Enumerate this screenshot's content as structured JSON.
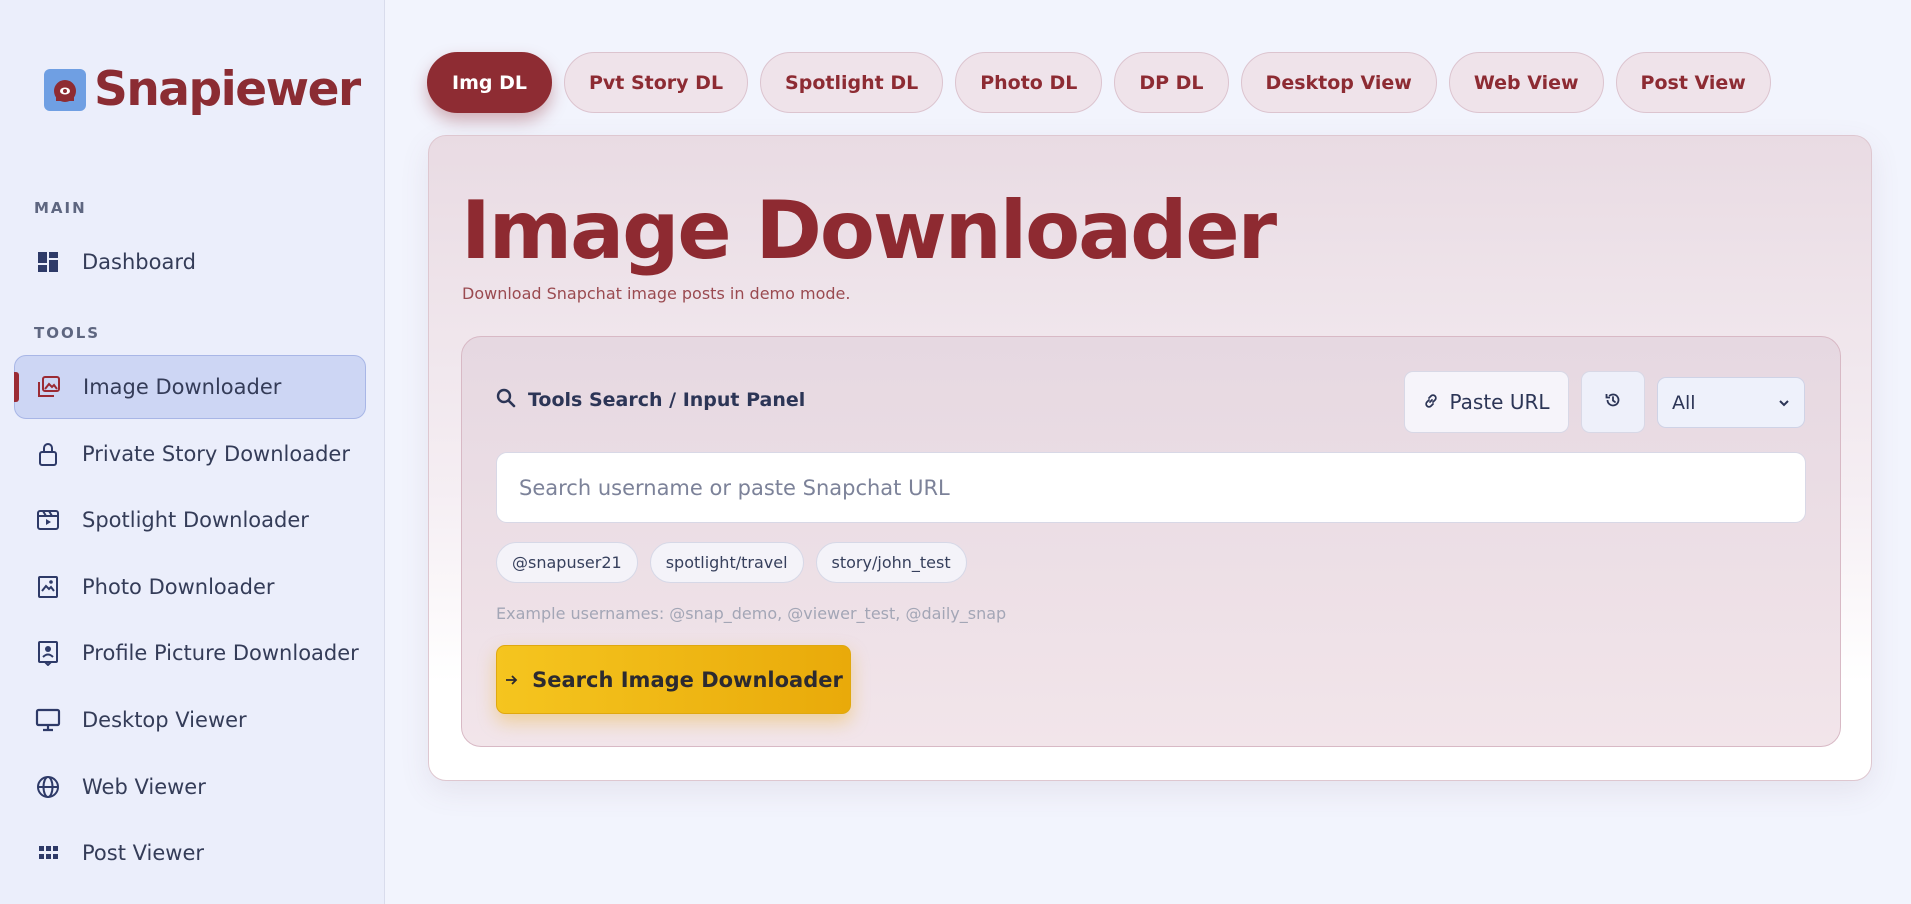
{
  "brand": {
    "name": "Snapiewer"
  },
  "sidebar": {
    "sections": [
      {
        "label": "MAIN"
      },
      {
        "label": "TOOLS"
      }
    ],
    "items": [
      {
        "label": "Dashboard",
        "icon": "dashboard-icon"
      },
      {
        "label": "Image Downloader",
        "icon": "images-icon",
        "active": true
      },
      {
        "label": "Private Story Downloader",
        "icon": "lock-icon"
      },
      {
        "label": "Spotlight Downloader",
        "icon": "video-clapper-icon"
      },
      {
        "label": "Photo Downloader",
        "icon": "photo-icon"
      },
      {
        "label": "Profile Picture Downloader",
        "icon": "profile-picture-icon"
      },
      {
        "label": "Desktop Viewer",
        "icon": "monitor-icon"
      },
      {
        "label": "Web Viewer",
        "icon": "globe-icon"
      },
      {
        "label": "Post Viewer",
        "icon": "grid-icon"
      }
    ]
  },
  "tabs": [
    {
      "label": "Img DL",
      "active": true
    },
    {
      "label": "Pvt Story DL"
    },
    {
      "label": "Spotlight DL"
    },
    {
      "label": "Photo DL"
    },
    {
      "label": "DP DL"
    },
    {
      "label": "Desktop View"
    },
    {
      "label": "Web View"
    },
    {
      "label": "Post View"
    }
  ],
  "main": {
    "title": "Image Downloader",
    "subtitle": "Download Snapchat image posts in demo mode.",
    "panel": {
      "title": "Tools Search / Input Panel",
      "paste_label": "Paste URL",
      "filter_value": "All",
      "search_placeholder": "Search username or paste Snapchat URL",
      "chips": [
        "@snapuser21",
        "spotlight/travel",
        "story/john_test"
      ],
      "examples": "Example usernames: @snap_demo, @viewer_test, @daily_snap",
      "search_button": "Search Image Downloader"
    }
  },
  "colors": {
    "brand": "#8e2c33",
    "accent": "#f0b718",
    "active_nav_bg": "#cdd6f4"
  }
}
